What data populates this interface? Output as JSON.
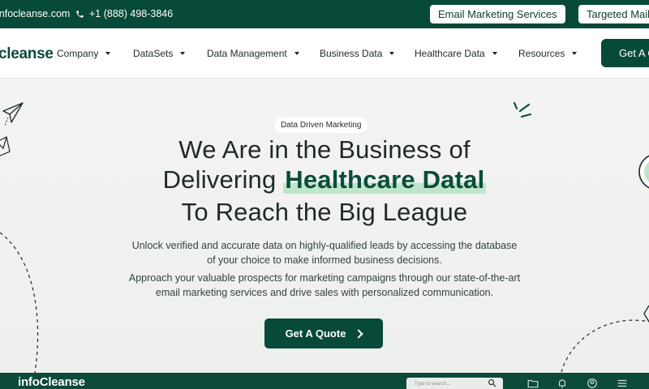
{
  "topbar": {
    "email": "infocleanse.com",
    "phone": "+1 (888) 498-3846",
    "pill_1": "Email Marketing Services",
    "pill_2": "Targeted Mailing"
  },
  "nav": {
    "logo": "cleanse",
    "items": [
      {
        "label": "Company"
      },
      {
        "label": "DataSets"
      },
      {
        "label": "Data Management"
      },
      {
        "label": "Business Data"
      },
      {
        "label": "Healthcare Data"
      },
      {
        "label": "Resources"
      }
    ],
    "cta": "Get A Quote"
  },
  "hero": {
    "badge": "Data Driven Marketing",
    "line1": "We Are in the Business of",
    "line2_prefix": "Delivering",
    "line2_highlight": "Healthcare Datal",
    "line3": "To Reach the Big League",
    "para1_a": "Unlock verified and accurate data on highly-qualified leads by accessing the database",
    "para1_b": "of your choice to make informed business decisions.",
    "para2_a": "Approach your valuable prospects for marketing campaigns through our state-of-the-art",
    "para2_b": "email marketing services and drive sales with personalized communication.",
    "button": "Get A Quote"
  },
  "bottombar": {
    "logo": "infoCleanse",
    "search_placeholder": "Type to search..."
  },
  "colors": {
    "brand": "#074a39",
    "highlight": "#bfe6c9"
  }
}
